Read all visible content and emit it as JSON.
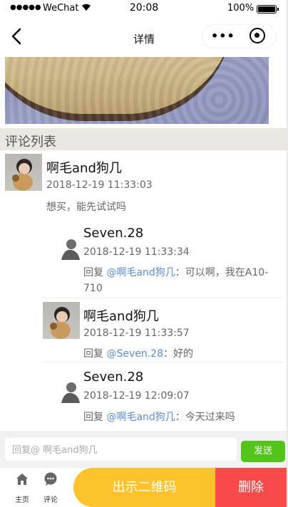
{
  "status_bar": {
    "signal": "●●●●●",
    "carrier": "WeChat",
    "time": "20:08",
    "battery": "100%"
  },
  "nav": {
    "title": "详情",
    "more_glyph": "•••"
  },
  "section": {
    "title": "评论列表"
  },
  "comments": [
    {
      "author": "啊毛and狗几",
      "date": "2018-12-19 11:33:03",
      "text": "想买，能先试试吗",
      "replies": [
        {
          "author": "Seven.28",
          "date": "2018-12-19 11:33:34",
          "reply_prefix": "回复",
          "mention": "@啊毛and狗几",
          "separator": "：",
          "text": "可以啊，我在A10-710"
        },
        {
          "author": "啊毛and狗几",
          "date": "2018-12-19 11:33:57",
          "reply_prefix": "回复",
          "mention": "@Seven.28",
          "separator": "：",
          "text": "好的"
        },
        {
          "author": "Seven.28",
          "date": "2018-12-19 12:09:07",
          "reply_prefix": "回复",
          "mention": "@啊毛and狗几",
          "separator": "：",
          "text": "今天过来吗"
        }
      ]
    }
  ],
  "input": {
    "placeholder": "回复@ 啊毛and狗几",
    "send_label": "发送"
  },
  "toolbar": {
    "home_label": "主页",
    "comment_label": "评论",
    "qr_button": "出示二维码",
    "delete_button": "删除"
  },
  "colors": {
    "send": "#53c41a",
    "qr": "#fdc32c",
    "delete": "#f84a4a",
    "mention": "#5b8bd0",
    "section_bg": "#ebe8e2"
  }
}
